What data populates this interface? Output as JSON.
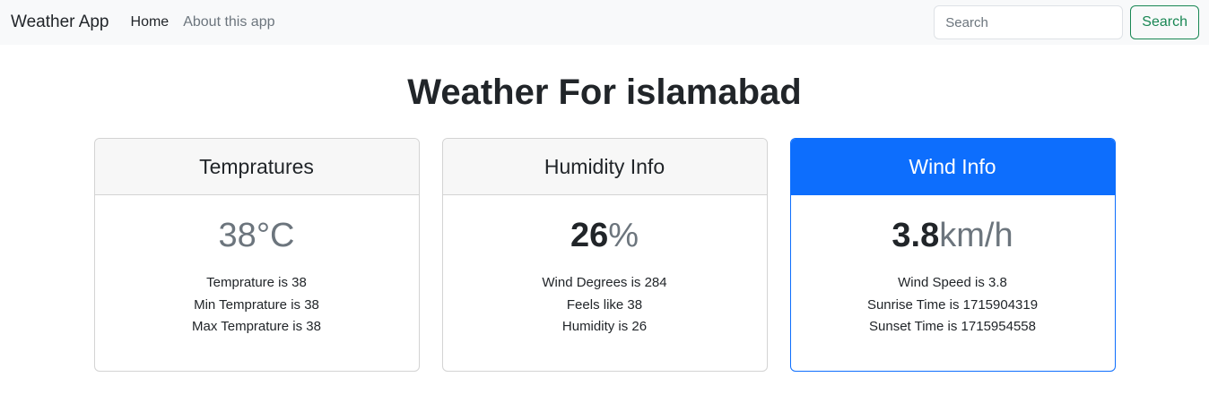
{
  "navbar": {
    "brand": "Weather App",
    "links": [
      {
        "label": "Home",
        "active": true
      },
      {
        "label": "About this app",
        "active": false
      }
    ],
    "search": {
      "placeholder": "Search",
      "value": ""
    },
    "search_button": "Search"
  },
  "page": {
    "title": "Weather For islamabad"
  },
  "cards": {
    "temperature": {
      "header": "Tempratures",
      "main_value": "38°C",
      "lines": [
        "Temprature is 38",
        "Min Temprature is 38",
        "Max Temprature is 38"
      ]
    },
    "humidity": {
      "header": "Humidity Info",
      "main_value": "26",
      "main_unit": "%",
      "lines": [
        "Wind Degrees is 284",
        "Feels like 38",
        "Humidity is 26"
      ]
    },
    "wind": {
      "header": "Wind Info",
      "main_value": "3.8",
      "main_unit": "km/h",
      "lines": [
        "Wind Speed is 3.8",
        "Sunrise Time is 1715904319",
        "Sunset Time is 1715954558"
      ]
    }
  },
  "colors": {
    "primary": "#0d6efd",
    "success": "#198754",
    "navbar_bg": "#f8f9fa",
    "muted": "#6c757d"
  }
}
